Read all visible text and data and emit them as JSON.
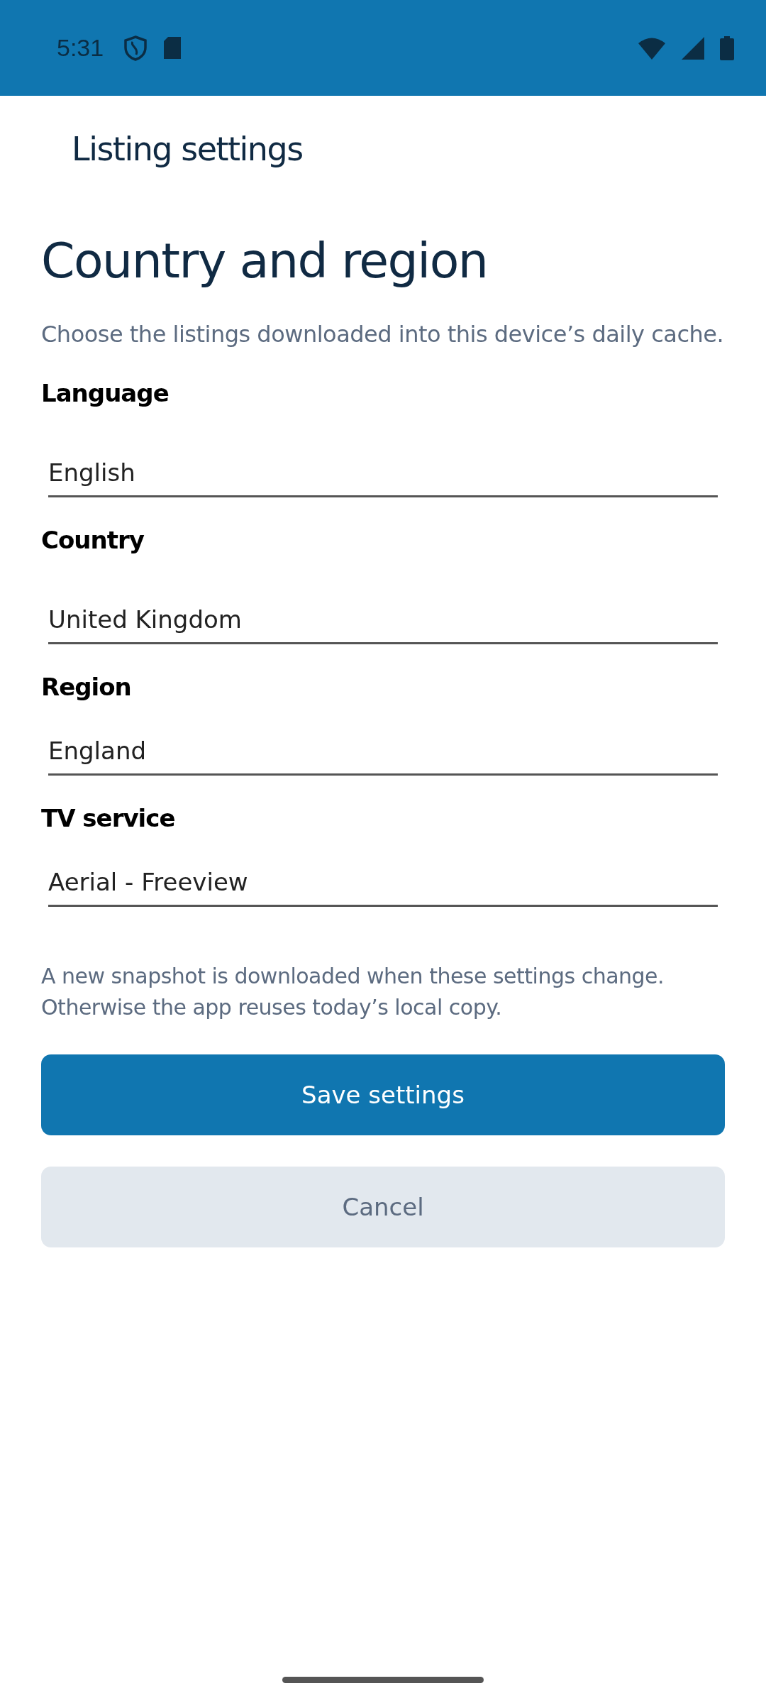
{
  "status_bar": {
    "time": "5:31"
  },
  "app_bar": {
    "title": "Listing settings"
  },
  "heading": "Country and region",
  "description": "Choose the listings downloaded into this device’s daily cache.",
  "fields": [
    {
      "label": "Language",
      "value": "English"
    },
    {
      "label": "Country",
      "value": "United Kingdom"
    },
    {
      "label": "Region",
      "value": "England"
    },
    {
      "label": "TV service",
      "value": "Aerial - Freeview"
    }
  ],
  "note": "A new snapshot is downloaded when these settings change. Otherwise the app reuses today’s local copy.",
  "buttons": [
    {
      "label": "Save settings",
      "kind": "primary"
    },
    {
      "label": "Cancel",
      "kind": "secondary"
    }
  ]
}
